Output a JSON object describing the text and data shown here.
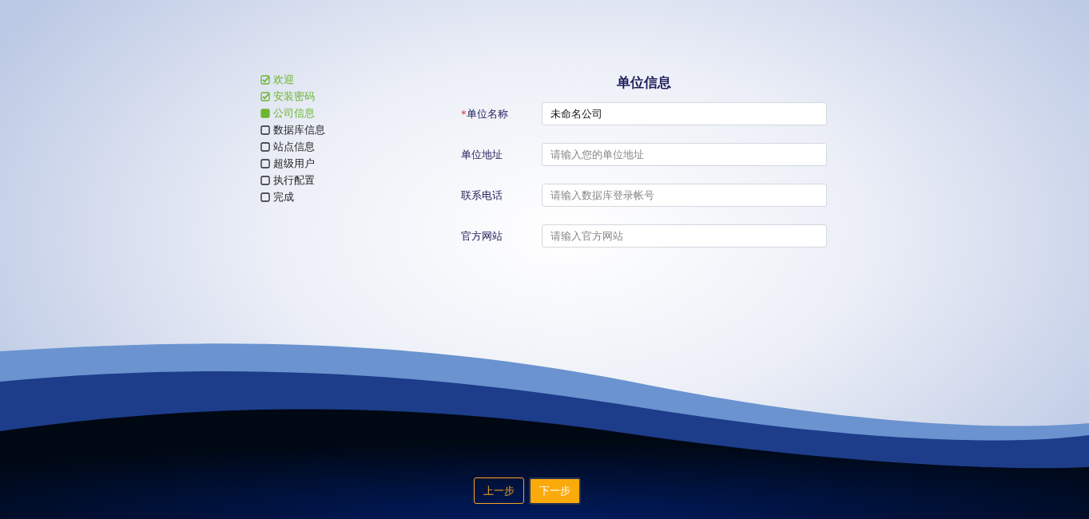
{
  "steps": [
    {
      "label": "欢迎",
      "checked": true,
      "selected": false
    },
    {
      "label": "安装密码",
      "checked": true,
      "selected": false
    },
    {
      "label": "公司信息",
      "checked": false,
      "selected": true
    },
    {
      "label": "数据库信息",
      "checked": false,
      "selected": false
    },
    {
      "label": "站点信息",
      "checked": false,
      "selected": false
    },
    {
      "label": "超级用户",
      "checked": false,
      "selected": false
    },
    {
      "label": "执行配置",
      "checked": false,
      "selected": false
    },
    {
      "label": "完成",
      "checked": false,
      "selected": false
    }
  ],
  "form": {
    "title": "单位信息",
    "fields": [
      {
        "label": "单位名称",
        "required_mark": "*",
        "value": "未命名公司"
      },
      {
        "label": "单位地址",
        "placeholder": "请输入您的单位地址"
      },
      {
        "label": "联系电话",
        "placeholder": "请输入数据库登录帐号"
      },
      {
        "label": "官方网站",
        "placeholder": "请输入官方网站"
      }
    ]
  },
  "buttons": [
    {
      "label": "上一步",
      "kind": "secondary"
    },
    {
      "label": "下一步",
      "kind": "primary"
    }
  ]
}
